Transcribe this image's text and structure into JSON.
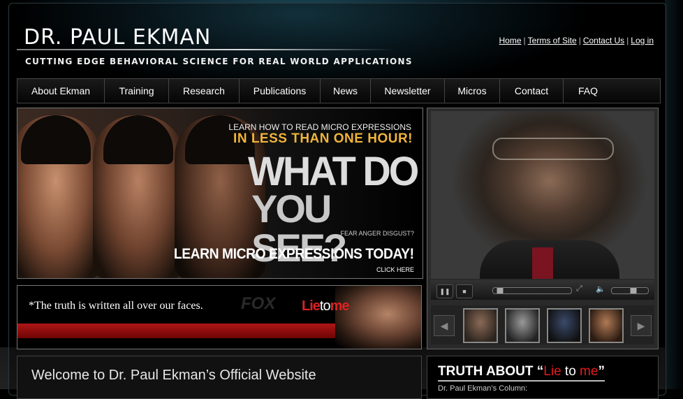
{
  "header": {
    "logo": "DR. PAUL EKMAN",
    "tagline": "CUTTING EDGE BEHAVIORAL SCIENCE FOR REAL WORLD APPLICATIONS",
    "links": [
      "Home",
      "Terms of Site",
      "Contact Us",
      "Log in"
    ]
  },
  "nav": {
    "items": [
      "About Ekman",
      "Training",
      "Research",
      "Publications",
      "News",
      "Newsletter",
      "Micros",
      "Contact",
      "FAQ"
    ]
  },
  "banner": {
    "line1": "LEARN HOW TO READ MICRO EXPRESSIONS",
    "line2": "IN LESS THAN ONE HOUR!",
    "what": "WHAT DO",
    "you": "YOU SEE?",
    "emotions": "FEAR ANGER DISGUST?",
    "cta": "LEARN MICRO EXPRESSIONS TODAY!",
    "click": "CLICK HERE",
    "accent": "#f0b43a"
  },
  "lie_banner": {
    "quote": "*The truth is written all over our faces.",
    "network": "FOX",
    "logo_lie": "Lie",
    "logo_to": "to",
    "logo_me": "me",
    "accent": "#b01616"
  },
  "video": {
    "progress": 0.05,
    "volume": 0.6,
    "thumbnails": 4
  },
  "welcome": {
    "title": "Welcome to Dr. Paul Ekman’s Official Website"
  },
  "truth": {
    "prefix": "TRUTH ABOUT “",
    "lie": "Lie",
    "to": " to ",
    "me": "me",
    "suffix": "”",
    "subtitle": "Dr. Paul Ekman’s Column:",
    "accent": "#e31b1b"
  }
}
